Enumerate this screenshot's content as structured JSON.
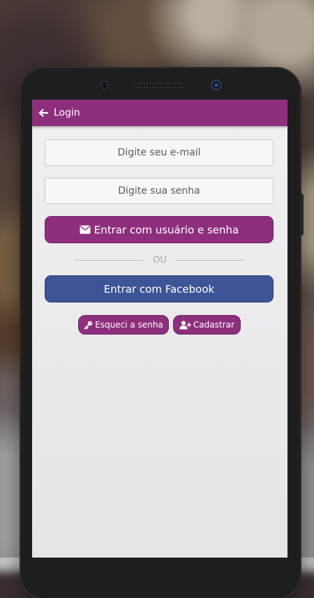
{
  "appbar": {
    "title": "Login",
    "back_icon": "arrow-left-icon",
    "color": "#8e2f7e"
  },
  "form": {
    "email_placeholder": "Digite seu e-mail",
    "password_placeholder": "Digite sua senha",
    "login_button": "Entrar com usuário e senha",
    "login_icon": "envelope-icon",
    "divider_text": "OU",
    "facebook_button": "Entrar com Facebook",
    "facebook_color": "#3d5596"
  },
  "links": {
    "forgot_label": "Esqueci a senha",
    "forgot_icon": "key-icon",
    "register_label": "Cadastrar",
    "register_icon": "user-plus-icon"
  }
}
